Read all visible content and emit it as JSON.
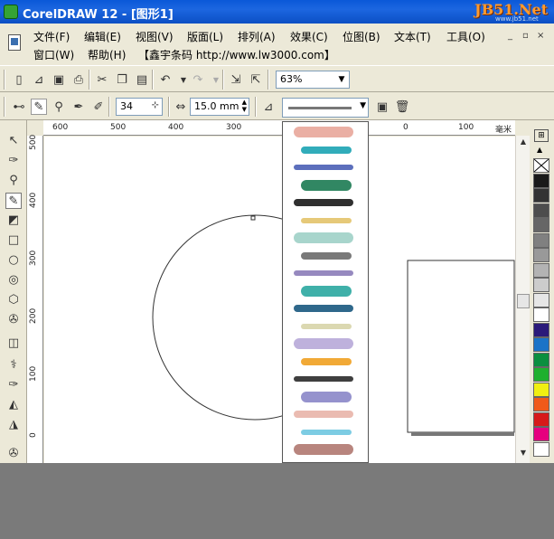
{
  "window": {
    "title": "CorelDRAW 12 - [图形1]",
    "watermark": "JB51.Net",
    "watermark_sub": "www.jb51.net"
  },
  "menubar": {
    "row1": [
      "文件(F)",
      "编辑(E)",
      "视图(V)",
      "版面(L)",
      "排列(A)",
      "效果(C)",
      "位图(B)",
      "文本(T)",
      "工具(O)"
    ],
    "row2": [
      "窗口(W)",
      "帮助(H)",
      "【鑫宇条码 http://www.lw3000.com】"
    ],
    "mdi_buttons": [
      "_",
      "▫",
      "×"
    ]
  },
  "toolbar": {
    "zoom": "63%",
    "brush_size": "34",
    "stroke_width": "15.0 mm"
  },
  "ruler": {
    "horizontal": [
      "600",
      "500",
      "400",
      "300",
      "0",
      "100"
    ],
    "horizontal_unit": "毫米",
    "vertical": [
      "500",
      "400",
      "300",
      "200",
      "100",
      "0"
    ]
  },
  "palette": {
    "colors": [
      "#ffffff",
      "#1a1a1a",
      "#333333",
      "#4d4d4d",
      "#666666",
      "#808080",
      "#999999",
      "#b3b3b3",
      "#cccccc",
      "#e6e6e6",
      "#ffffff",
      "#2b1a7a",
      "#1a73c7",
      "#0b8f3f",
      "#1fb02e",
      "#f0ef12",
      "#f05a1a",
      "#d61a1a",
      "#e6007e",
      "#ffffff"
    ]
  },
  "brushes": {
    "colors": [
      "#e8a69a",
      "#1ba3b3",
      "#4a5fb5",
      "#1b7a52",
      "#1a1a1a",
      "#e3c36a",
      "#9fd0c6",
      "#6a6a6a",
      "#8b7cb8",
      "#2aa7a0",
      "#18587e",
      "#d7d4a8",
      "#b7a8d8",
      "#f0a020",
      "#2a2a2a",
      "#8a86c8",
      "#e8b4a8",
      "#6fc6e0",
      "#b07870"
    ]
  }
}
